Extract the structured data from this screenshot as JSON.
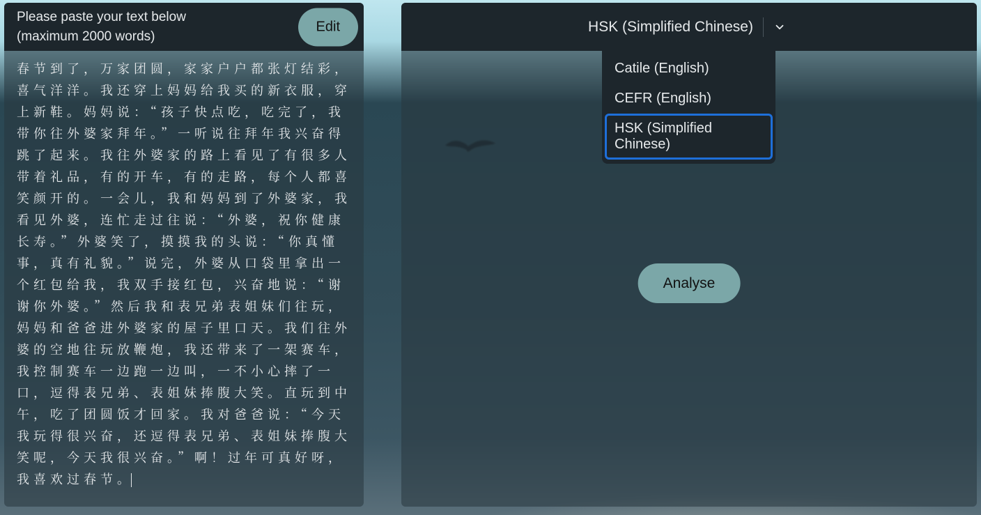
{
  "left_panel": {
    "title_line1": "Please paste your text below",
    "title_line2": "(maximum 2000 words)",
    "edit_label": "Edit",
    "text": "春节到了，万家团圆，家家户户都张灯结彩，喜气洋洋。我还穿上妈妈给我买的新衣服，穿上新鞋。妈妈说：“孩子快点吃，吃完了，我带你往外婆家拜年。”一听说往拜年我兴奋得跳了起来。我往外婆家的路上看见了有很多人带着礼品，有的开车，有的走路，每个人都喜笑颜开的。一会儿，我和妈妈到了外婆家，我看见外婆，连忙走过往说：“外婆，祝你健康长寿。”外婆笑了，摸摸我的头说：“你真懂事，真有礼貌。”说完，外婆从口袋里拿出一个红包给我，我双手接红包，兴奋地说：“谢谢你外婆。”然后我和表兄弟表姐妹们往玩，妈妈和爸爸进外婆家的屋子里口天。我们往外婆的空地往玩放鞭炮，我还带来了一架赛车，我控制赛车一边跑一边叫，一不小心摔了一口，逗得表兄弟、表姐妹捧腹大笑。直玩到中午，吃了团圆饭才回家。我对爸爸说：“今天我玩得很兴奋，还逗得表兄弟、表姐妹捧腹大笑呢，今天我很兴奋。”啊！过年可真好呀，我喜欢过春节。"
  },
  "right_panel": {
    "selected_label": "HSK (Simplified Chinese)",
    "options": [
      {
        "label": "Catile (English)"
      },
      {
        "label": "CEFR (English)"
      },
      {
        "label": "HSK (Simplified Chinese)",
        "selected": true
      }
    ],
    "analyse_label": "Analyse"
  },
  "colors": {
    "accent_button": "#7ba7a8",
    "header_bg": "#1d262c",
    "focus_ring": "#1e6fd9"
  }
}
